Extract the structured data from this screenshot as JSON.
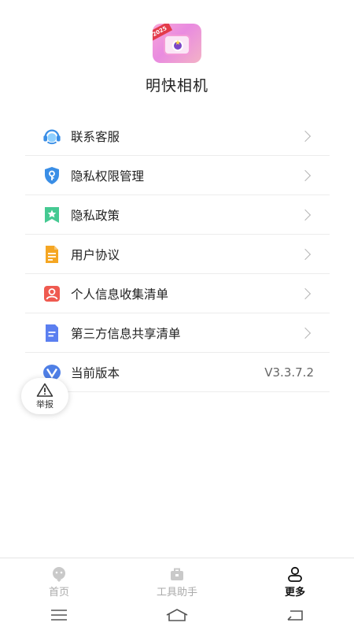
{
  "app": {
    "name": "明快相机",
    "logo_badge": "2025"
  },
  "menu": {
    "items": [
      {
        "label": "联系客服",
        "icon": "customer-service-icon"
      },
      {
        "label": "隐私权限管理",
        "icon": "shield-key-icon"
      },
      {
        "label": "隐私政策",
        "icon": "bookmark-star-icon"
      },
      {
        "label": "用户协议",
        "icon": "document-icon"
      },
      {
        "label": "个人信息收集清单",
        "icon": "person-icon"
      },
      {
        "label": "第三方信息共享清单",
        "icon": "list-file-icon"
      },
      {
        "label": "当前版本",
        "icon": "version-v-icon",
        "value": "V3.3.7.2"
      }
    ]
  },
  "report": {
    "label": "举报",
    "icon": "warning-icon"
  },
  "tabs": [
    {
      "label": "首页",
      "icon": "home-face-icon",
      "active": false
    },
    {
      "label": "工具助手",
      "icon": "toolbox-icon",
      "active": false
    },
    {
      "label": "更多",
      "icon": "user-icon",
      "active": true
    }
  ],
  "colors": {
    "accent": "#111111",
    "inactive_tab": "#aaaaaa",
    "divider": "#ececec"
  }
}
